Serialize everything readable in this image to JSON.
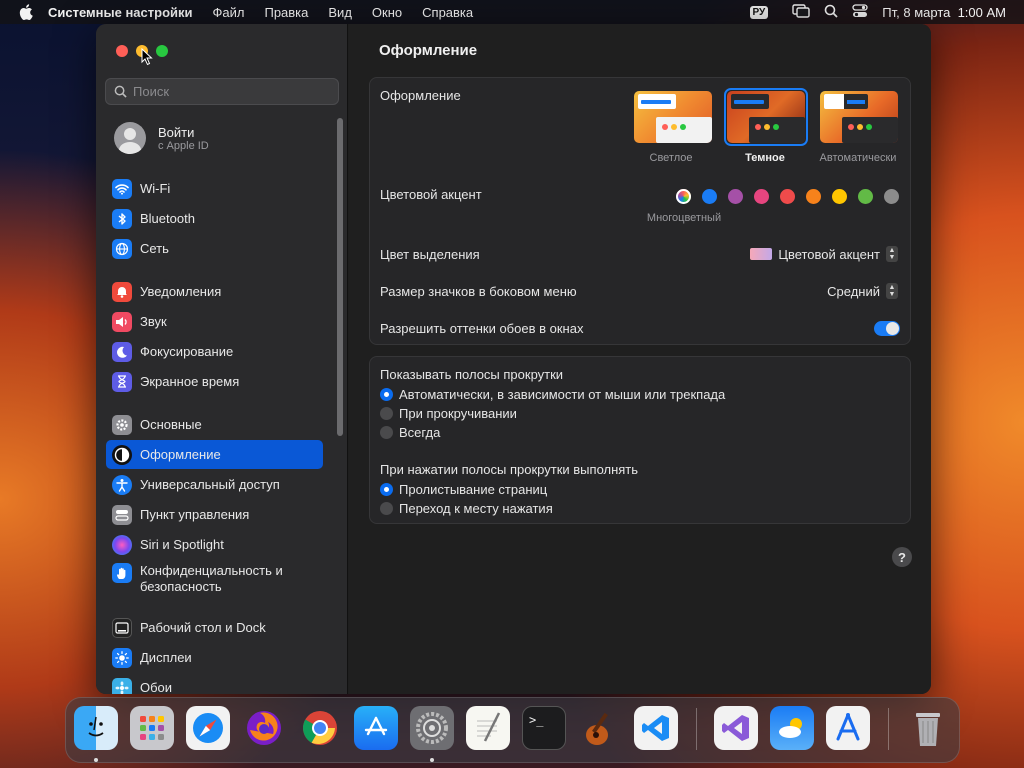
{
  "menubar": {
    "app": "Системные настройки",
    "items": [
      "Файл",
      "Правка",
      "Вид",
      "Окно",
      "Справка"
    ],
    "input_lang": "РУ",
    "datetime": "Пт, 8 марта  1:00 AM"
  },
  "sidebar": {
    "search_placeholder": "Поиск",
    "apple_id": {
      "title": "Войти",
      "subtitle": "с Apple ID"
    },
    "items": [
      {
        "label": "Wi-Fi",
        "icon": "wifi-icon",
        "color": "#1a7cf5"
      },
      {
        "label": "Bluetooth",
        "icon": "bluetooth-icon",
        "color": "#1a7cf5"
      },
      {
        "label": "Сеть",
        "icon": "globe-icon",
        "color": "#1a7cf5"
      },
      {
        "label": "Уведомления",
        "icon": "bell-icon",
        "color": "#f04a3c"
      },
      {
        "label": "Звук",
        "icon": "speaker-icon",
        "color": "#f04a62"
      },
      {
        "label": "Фокусирование",
        "icon": "moon-icon",
        "color": "#5e5ce6"
      },
      {
        "label": "Экранное время",
        "icon": "hourglass-icon",
        "color": "#5e5ce6"
      },
      {
        "label": "Основные",
        "icon": "gear-icon",
        "color": "#8e8e93"
      },
      {
        "label": "Оформление",
        "icon": "appearance-icon",
        "color": "#111111"
      },
      {
        "label": "Универсальный доступ",
        "icon": "accessibility-icon",
        "color": "#1a7cf5"
      },
      {
        "label": "Пункт управления",
        "icon": "control-center-icon",
        "color": "#8e8e93"
      },
      {
        "label": "Siri и Spotlight",
        "icon": "siri-icon",
        "color": "#b04ad8"
      },
      {
        "label": "Конфиденциальность и безопасность",
        "icon": "hand-icon",
        "color": "#1a7cf5"
      },
      {
        "label": "Рабочий стол и Dock",
        "icon": "dock-icon",
        "color": "#222222"
      },
      {
        "label": "Дисплеи",
        "icon": "sun-icon",
        "color": "#1a7cf5"
      },
      {
        "label": "Обои",
        "icon": "wallpaper-icon",
        "color": "#3ab0e8"
      }
    ]
  },
  "main": {
    "title": "Оформление",
    "appearance": {
      "label": "Оформление",
      "options": [
        {
          "caption": "Светлое",
          "selected": false
        },
        {
          "caption": "Темное",
          "selected": true
        },
        {
          "caption": "Автоматически",
          "selected": false
        }
      ]
    },
    "accent": {
      "label": "Цветовой акцент",
      "caption": "Многоцветный",
      "colors": [
        "#1a7cf5",
        "#a550a7",
        "#e6457f",
        "#ef4b4b",
        "#f7821b",
        "#ffc600",
        "#62ba46",
        "#8c8c8c"
      ]
    },
    "highlight": {
      "label": "Цвет выделения",
      "value": "Цветовой акцент"
    },
    "icon_size": {
      "label": "Размер значков в боковом меню",
      "value": "Средний"
    },
    "wallpaper_tint": {
      "label": "Разрешить оттенки обоев в окнах",
      "on": true
    },
    "scrollbars": {
      "label": "Показывать полосы прокрутки",
      "options": [
        {
          "label": "Автоматически, в зависимости от мыши или трекпада",
          "on": true
        },
        {
          "label": "При прокручивании",
          "on": false
        },
        {
          "label": "Всегда",
          "on": false
        }
      ]
    },
    "click": {
      "label": "При нажатии полосы прокрутки выполнять",
      "options": [
        {
          "label": "Пролистывание страниц",
          "on": true
        },
        {
          "label": "Переход к месту нажатия",
          "on": false
        }
      ]
    },
    "help_glyph": "?"
  },
  "dock": {
    "apps": [
      "finder-icon",
      "launchpad-icon",
      "safari-icon",
      "firefox-icon",
      "chrome-icon",
      "app-store-icon",
      "system-settings-icon",
      "textedit-icon",
      "terminal-icon",
      "garageband-icon",
      "vscode-icon",
      "visual-studio-icon",
      "weather-icon",
      "xcode-instruments-icon",
      "trash-icon"
    ]
  }
}
